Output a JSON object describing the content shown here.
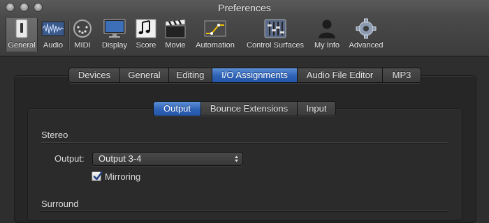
{
  "window": {
    "title": "Preferences"
  },
  "toolbar": {
    "items": [
      {
        "label": "General",
        "icon": "switch-icon",
        "active": true
      },
      {
        "label": "Audio",
        "icon": "waveform-icon"
      },
      {
        "label": "MIDI",
        "icon": "midi-connector-icon"
      },
      {
        "label": "Display",
        "icon": "monitor-icon"
      },
      {
        "label": "Score",
        "icon": "music-notes-icon"
      },
      {
        "label": "Movie",
        "icon": "clapperboard-icon"
      },
      {
        "label": "Automation",
        "icon": "automation-curve-icon"
      },
      {
        "label": "Control Surfaces",
        "icon": "faders-icon"
      },
      {
        "label": "My Info",
        "icon": "person-icon"
      },
      {
        "label": "Advanced",
        "icon": "gear-icon"
      }
    ]
  },
  "tabs": {
    "items": [
      "Devices",
      "General",
      "Editing",
      "I/O Assignments",
      "Audio File Editor",
      "MP3"
    ],
    "selected": "I/O Assignments"
  },
  "subtabs": {
    "items": [
      "Output",
      "Bounce Extensions",
      "Input"
    ],
    "selected": "Output"
  },
  "stereo": {
    "heading": "Stereo",
    "output_label": "Output:",
    "output_value": "Output 3-4",
    "mirroring_label": "Mirroring",
    "mirroring_checked": true
  },
  "surround": {
    "heading": "Surround"
  },
  "colors": {
    "accent": "#2e62b6",
    "background": "#2e2e2e"
  }
}
